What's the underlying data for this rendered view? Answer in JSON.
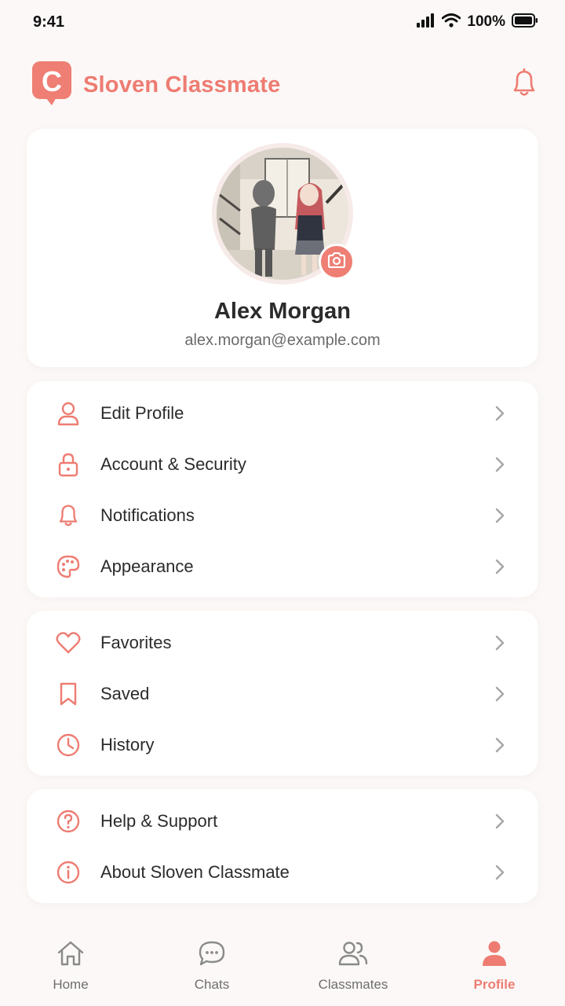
{
  "status_bar": {
    "time": "9:41",
    "battery": "100%"
  },
  "header": {
    "logo_letter": "C",
    "title": "Sloven Classmate"
  },
  "profile": {
    "name": "Alex Morgan",
    "email": "alex.morgan@example.com"
  },
  "menu_groups": [
    {
      "items": [
        {
          "label": "Edit Profile",
          "icon": "user-icon"
        },
        {
          "label": "Account & Security",
          "icon": "lock-icon"
        },
        {
          "label": "Notifications",
          "icon": "bell-icon"
        },
        {
          "label": "Appearance",
          "icon": "palette-icon"
        }
      ]
    },
    {
      "items": [
        {
          "label": "Favorites",
          "icon": "heart-icon"
        },
        {
          "label": "Saved",
          "icon": "bookmark-icon"
        },
        {
          "label": "History",
          "icon": "clock-icon"
        }
      ]
    },
    {
      "items": [
        {
          "label": "Help & Support",
          "icon": "help-icon"
        },
        {
          "label": "About Sloven Classmate",
          "icon": "info-icon"
        }
      ]
    }
  ],
  "tabs": [
    {
      "label": "Home",
      "icon": "home-icon",
      "active": false
    },
    {
      "label": "Chats",
      "icon": "chat-icon",
      "active": false
    },
    {
      "label": "Classmates",
      "icon": "people-icon",
      "active": false
    },
    {
      "label": "Profile",
      "icon": "profile-icon",
      "active": true
    }
  ],
  "colors": {
    "accent": "#ee7c72",
    "background": "#fbf8f7",
    "card": "#ffffff",
    "text": "#2b2b2b",
    "muted": "#6e6e6e"
  }
}
